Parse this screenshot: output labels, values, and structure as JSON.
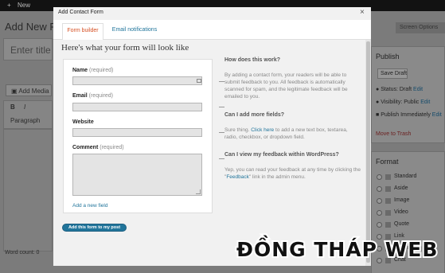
{
  "admin_bar": {
    "new_label": "New"
  },
  "background": {
    "page_title": "Add New P",
    "title_placeholder": "Enter title",
    "add_media": "Add Media",
    "toolbar": {
      "bold": "B",
      "italic": "I",
      "format": "Paragraph"
    },
    "word_count": "Word count: 0",
    "screen_options": "Screen Options",
    "publish_box": {
      "title": "Publish",
      "save_draft": "Save Draft",
      "status": "Status: Draft",
      "visibility": "Visibility: Public",
      "publish": "Publish Immediately",
      "edit": "Edit",
      "trash": "Move to Trash"
    },
    "format_box": {
      "title": "Format",
      "options": [
        "Standard",
        "Aside",
        "Image",
        "Video",
        "Quote",
        "Link",
        "Gallery",
        "Chat"
      ]
    }
  },
  "modal": {
    "title": "Add Contact Form",
    "close_glyph": "×",
    "tabs": [
      {
        "label": "Form builder",
        "active": true
      },
      {
        "label": "Email notifications",
        "active": false
      }
    ],
    "heading": "Here's what your form will look like",
    "fields": [
      {
        "label": "Name",
        "required": "(required)"
      },
      {
        "label": "Email",
        "required": "(required)"
      },
      {
        "label": "Website",
        "required": ""
      },
      {
        "label": "Comment",
        "required": "(required)"
      }
    ],
    "add_field": "Add a new field",
    "add_to_post": "Add this form to my post",
    "help": [
      {
        "q": "How does this work?",
        "a": "By adding a contact form, your readers will be able to submit feedback to you. All feedback is automatically scanned for spam, and the legitimate feedback will be emailed to you."
      },
      {
        "q": "Can I add more fields?",
        "a_before": "Sure thing. ",
        "a_link": "Click here",
        "a_after": " to add a new text box, textarea, radio, checkbox, or dropdown field."
      },
      {
        "q": "Can I view my feedback within WordPress?",
        "a_before": "Yep, you can read your feedback at any time by clicking the \"",
        "a_link": "Feedback",
        "a_after": "\" link in the admin menu."
      }
    ]
  },
  "watermark": {
    "text": "ĐỒNG THÁP WEB"
  },
  "colors": {
    "accent": "#21759b",
    "active_tab": "#d54e21"
  }
}
